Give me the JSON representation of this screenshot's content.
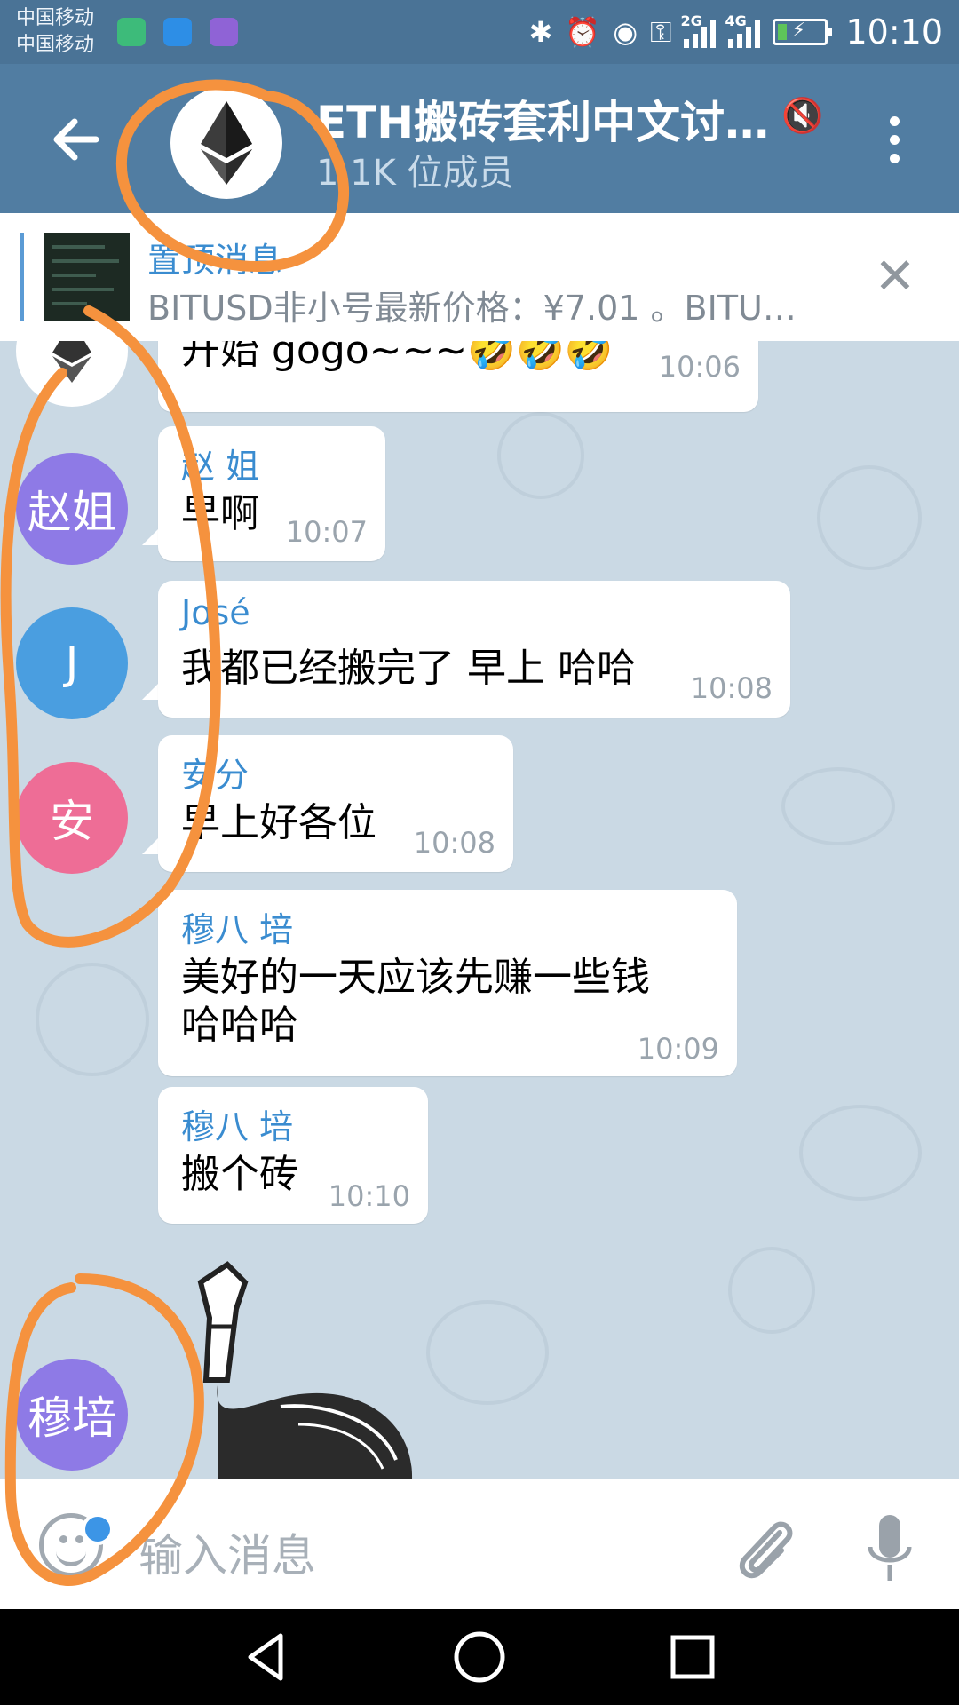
{
  "status_bar": {
    "carrier_1": "中国移动",
    "carrier_2": "中国移动",
    "net_1": "2G",
    "net_2": "4G",
    "time": "10:10",
    "battery_level": 0.2
  },
  "header": {
    "title": "ETH搬砖套利中文讨…",
    "subtitle": "1.1K 位成员"
  },
  "pinned": {
    "title": "置顶消息",
    "text": "BITUSD非小号最新价格：¥7.01 。BITU…"
  },
  "messages": [
    {
      "sender": "",
      "text": "开始 gogo~~~🤣🤣🤣",
      "time": "10:06"
    },
    {
      "sender": "赵 姐",
      "avatar": "赵姐",
      "avatar_color": "#8e7ae6",
      "text": "早啊",
      "time": "10:07"
    },
    {
      "sender": "José",
      "avatar": "J",
      "avatar_color": "#4a9ee0",
      "text": "我都已经搬完了 早上 哈哈",
      "time": "10:08"
    },
    {
      "sender": "安分",
      "avatar": "安",
      "avatar_color": "#ee6d96",
      "text": "早上好各位",
      "time": "10:08"
    },
    {
      "sender": "穆八 培",
      "text_line1": "美好的一天应该先赚一些钱",
      "text_line2": "哈哈哈",
      "time": "10:09"
    },
    {
      "sender": "穆八 培",
      "avatar": "穆培",
      "avatar_color": "#8e7ae6",
      "text": "搬个砖",
      "time": "10:10"
    }
  ],
  "input": {
    "placeholder": "输入消息"
  },
  "colors": {
    "header_bg": "#517da2",
    "accent": "#3a8cd0",
    "annotation": "#f5923e"
  },
  "icons": [
    "back-arrow-icon",
    "mute-icon",
    "more-vert-icon",
    "close-icon",
    "emoji-icon",
    "attach-icon",
    "mic-icon",
    "nav-back-icon",
    "nav-home-icon",
    "nav-recents-icon"
  ]
}
